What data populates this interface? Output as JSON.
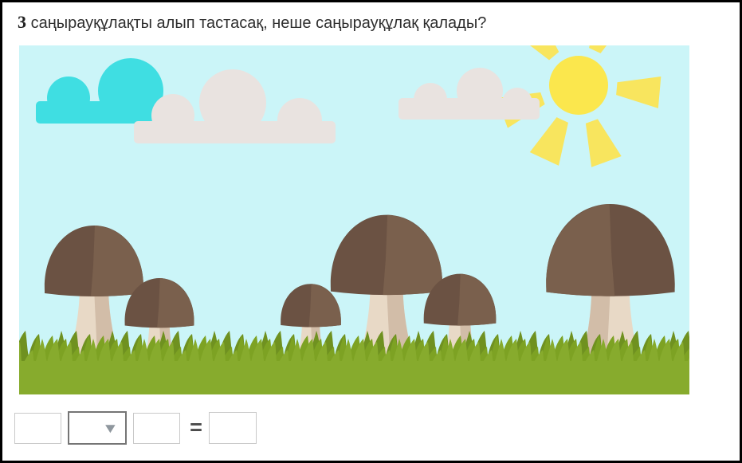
{
  "question": {
    "prefix": "3",
    "text": "саңырауқұлақты алып тастасақ, неше саңырауқұлақ қалады?"
  },
  "scene": {
    "description": "Flat-style meadow illustration: 6 brown mushrooms in green grass, 1 teal cloud, 2 gray clouds and a yellow sun in a light-cyan sky",
    "mushroom_count": 6,
    "cloud_count": 3,
    "sun_count": 1,
    "colors": {
      "sky": "#cbf5f8",
      "teal_cloud": "#3fdee2",
      "gray_cloud": "#e9e3e0",
      "sun": "#fbe74d",
      "sun_rays": "#f8e55e",
      "mushroom_cap_dark": "#6b5243",
      "mushroom_cap_light": "#7a604d",
      "mushroom_stem": "#e8d9c6",
      "mushroom_stem_shade": "#d2bda8",
      "grass_main": "#87ab2d",
      "grass_dark": "#6f9120"
    }
  },
  "equation": {
    "input1_value": "",
    "dropdown_value": "",
    "dropdown_arrow": "▼",
    "input2_value": "",
    "equals": "=",
    "answer_value": ""
  }
}
